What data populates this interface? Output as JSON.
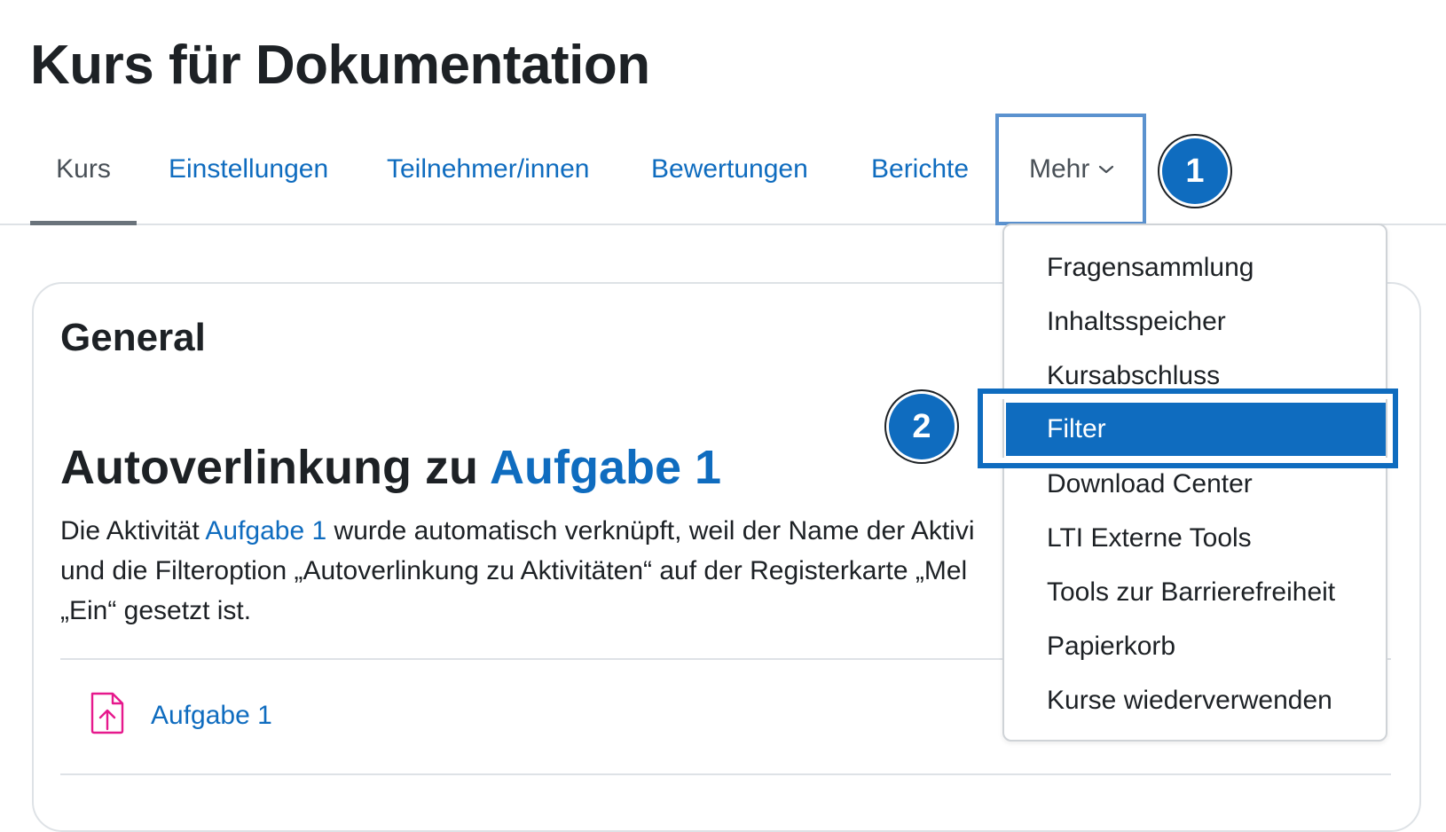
{
  "page": {
    "title": "Kurs für Dokumentation"
  },
  "nav": {
    "tabs": [
      {
        "label": "Kurs",
        "active": true
      },
      {
        "label": "Einstellungen"
      },
      {
        "label": "Teilnehmer/innen"
      },
      {
        "label": "Bewertungen"
      },
      {
        "label": "Berichte"
      }
    ],
    "more_label": "Mehr"
  },
  "callouts": {
    "first": "1",
    "second": "2"
  },
  "dropdown": {
    "items": [
      "Fragensammlung",
      "Inhaltsspeicher",
      "Kursabschluss",
      "Filter",
      "Download Center",
      "LTI Externe Tools",
      "Tools zur Barrierefreiheit",
      "Papierkorb",
      "Kurse wiederverwenden"
    ],
    "selected": "Filter"
  },
  "section": {
    "title": "General",
    "heading_prefix": "Autoverlinkung zu ",
    "heading_link": "Aufgabe 1",
    "para_line1_prefix": "Die Aktivität ",
    "para_line1_link": "Aufgabe 1",
    "para_line1_suffix": " wurde automatisch verknüpft, weil der Name der Aktivi",
    "para_line2": "und die Filteroption „Autoverlinkung zu Aktivitäten“ auf der Registerkarte „Mel",
    "para_line3": "„Ein“ gesetzt ist.",
    "activity_label": "Aufgabe 1"
  },
  "colors": {
    "primary": "#0f6cbf",
    "text": "#1d2125",
    "muted": "#495057",
    "assignment_icon": "#e6198d",
    "highlight_outline": "#5b92cf"
  },
  "icons": {
    "more": "chevron-down-icon",
    "activity": "assignment-upload-icon"
  }
}
